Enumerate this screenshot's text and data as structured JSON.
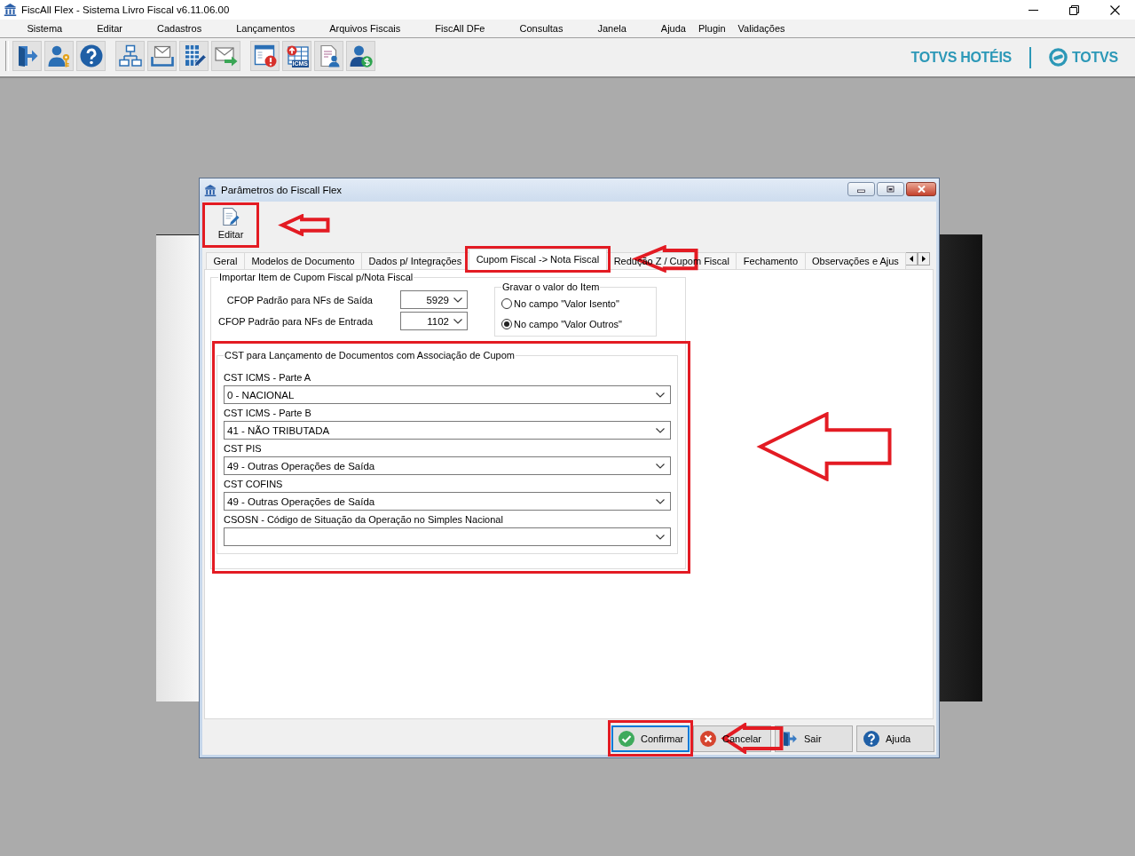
{
  "app_window": {
    "title": "FiscAll Flex - Sistema Livro Fiscal v6.11.06.00"
  },
  "menu_bar": [
    "Sistema",
    "Editar",
    "Cadastros",
    "Lançamentos",
    "Arquivos Fiscais",
    "FiscAll DFe",
    "Consultas",
    "Janela",
    "Ajuda",
    "Plugin",
    "Validações"
  ],
  "toolbar": {
    "groups": [
      {
        "buttons": [
          {
            "kind": "exit"
          },
          {
            "kind": "user-key"
          },
          {
            "kind": "help"
          }
        ]
      },
      {
        "buttons": [
          {
            "kind": "org-chart"
          },
          {
            "kind": "inbox"
          },
          {
            "kind": "grid-edit"
          },
          {
            "kind": "mail-send"
          }
        ]
      },
      {
        "buttons": [
          {
            "kind": "window-alert"
          },
          {
            "kind": "table-upload",
            "badge": "ICMS"
          },
          {
            "kind": "document-user"
          },
          {
            "kind": "user-dollar"
          }
        ]
      }
    ]
  },
  "branding": {
    "product": "TOTVS HOTÉIS",
    "logo": "TOTVS"
  },
  "dialog": {
    "title": "Parâmetros do Fiscall Flex",
    "toolbar": [
      {
        "kind": "edit",
        "label": "Editar",
        "highlighted": true
      }
    ],
    "tabs": [
      {
        "label": "Geral",
        "selected": false,
        "highlighted": false
      },
      {
        "label": "Modelos de Documento",
        "selected": false,
        "highlighted": false
      },
      {
        "label": "Dados p/ Integrações",
        "selected": false,
        "highlighted": false
      },
      {
        "label": "Cupom Fiscal -> Nota Fiscal",
        "selected": true,
        "highlighted": true
      },
      {
        "label": "Redução Z / Cupom Fiscal",
        "selected": false,
        "highlighted": false
      },
      {
        "label": "Fechamento",
        "selected": false,
        "highlighted": false
      },
      {
        "label": "Observações e Ajus",
        "selected": false,
        "highlighted": false
      }
    ],
    "import_group": {
      "title": "Importar Item de Cupom Fiscal p/Nota Fiscal",
      "cfop_fields": [
        {
          "label": "CFOP Padrão para NFs de Saída",
          "value": "5929"
        },
        {
          "label": "CFOP Padrão para NFs de Entrada",
          "value": "1102"
        }
      ],
      "value_group": {
        "title": "Gravar o valor do Item",
        "options": [
          {
            "label": "No campo \"Valor Isento\"",
            "selected": false
          },
          {
            "label": "No campo \"Valor Outros\"",
            "selected": true
          }
        ]
      },
      "cst_group": {
        "title": "CST para Lançamento de Documentos com Associação de Cupom",
        "highlighted": true,
        "fields": [
          {
            "label": "CST ICMS - Parte A",
            "value": "0 - NACIONAL"
          },
          {
            "label": "CST ICMS - Parte B",
            "value": "41 - NÃO TRIBUTADA"
          },
          {
            "label": "CST PIS",
            "value": "49 - Outras Operações de Saída"
          },
          {
            "label": "CST COFINS",
            "value": "49 - Outras Operações de Saída"
          },
          {
            "label": "CSOSN - Código de Situação da Operação no Simples Nacional"
          }
        ]
      }
    },
    "buttons": [
      {
        "kind": "confirm",
        "label": "Confirmar",
        "focused": true,
        "highlighted": true
      },
      {
        "kind": "cancel",
        "label": "Cancelar",
        "focused": false,
        "highlighted": false
      },
      {
        "kind": "exit",
        "label": "Sair",
        "focused": false,
        "highlighted": false
      },
      {
        "kind": "help",
        "label": "Ajuda",
        "focused": false,
        "highlighted": false
      }
    ]
  }
}
